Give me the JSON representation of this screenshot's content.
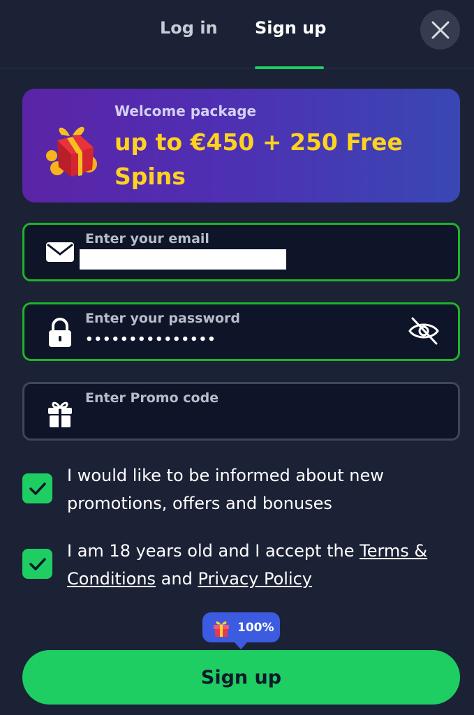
{
  "tabs": [
    {
      "label": "Log in",
      "active": false
    },
    {
      "label": "Sign up",
      "active": true
    }
  ],
  "banner": {
    "subtitle": "Welcome package",
    "title": "up to €450 + 250 Free Spins",
    "icon": "gift-box-icon"
  },
  "form": {
    "email": {
      "placeholder": "Enter your email",
      "value": "",
      "icon": "envelope-icon"
    },
    "password": {
      "placeholder": "Enter your password",
      "value": "•••••••••••••••",
      "icon": "lock-icon",
      "toggle_icon": "eye-off-icon"
    },
    "promo": {
      "placeholder": "Enter Promo code",
      "value": "",
      "icon": "gift-icon"
    }
  },
  "consents": {
    "promotions": {
      "checked": true,
      "text": "I would like to be informed about new promotions, offers and bonuses"
    },
    "terms": {
      "checked": true,
      "prefix": "I am 18 years old and I accept the ",
      "terms_link": "Terms & Conditions",
      "middle": " and ",
      "privacy_link": "Privacy Policy"
    }
  },
  "badge": {
    "text": "100%",
    "icon": "gift-icon"
  },
  "submit_label": "Sign up",
  "colors": {
    "background": "#1b2235",
    "accent_green": "#1fce62",
    "field_border_valid": "#1fb32b",
    "banner_title": "#ffd21f",
    "badge_blue": "#3c5be0"
  }
}
